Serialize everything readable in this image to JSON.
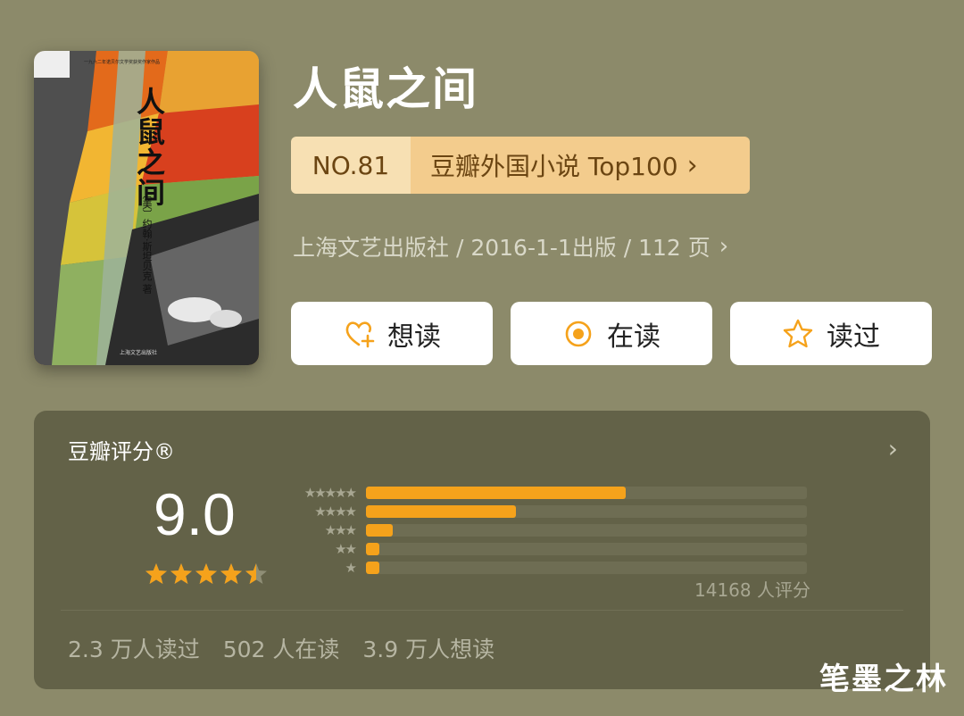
{
  "book": {
    "title": "人鼠之间",
    "cover": {
      "title": "人鼠之间",
      "author": "〔美〕约翰·斯坦贝克 著",
      "series": "一九六二年诺贝尔文学奖获奖作家作品",
      "publisher": "上海文艺出版社"
    }
  },
  "ranking": {
    "number": "NO.81",
    "list": "豆瓣外国小说 Top100",
    "chevron": "›"
  },
  "meta": {
    "text": "上海文艺出版社 / 2016-1-1出版 / 112 页",
    "chevron": "›"
  },
  "actions": [
    {
      "label": "想读",
      "icon": "heart-plus-icon"
    },
    {
      "label": "在读",
      "icon": "reading-dot-icon"
    },
    {
      "label": "读过",
      "icon": "star-outline-icon"
    }
  ],
  "rating": {
    "title": "豆瓣评分®",
    "score": "9.0",
    "stars": 4.5,
    "distribution": [
      {
        "stars": "★★★★★",
        "fraction": 0.59
      },
      {
        "stars": "★★★★",
        "fraction": 0.34
      },
      {
        "stars": "★★★",
        "fraction": 0.06
      },
      {
        "stars": "★★",
        "fraction": 0.03
      },
      {
        "stars": "★",
        "fraction": 0.03
      }
    ],
    "count": "14168 人评分",
    "chevron": "›"
  },
  "stats": {
    "read": "2.3 万人读过",
    "reading": "502 人在读",
    "want": "3.9 万人想读"
  },
  "watermark": "笔墨之林",
  "colors": {
    "background": "#8c8a6a",
    "panel": "#636248",
    "accent": "#f5a21b",
    "badge_light": "#f7e0b3",
    "badge_dark": "#f3cc8d"
  }
}
